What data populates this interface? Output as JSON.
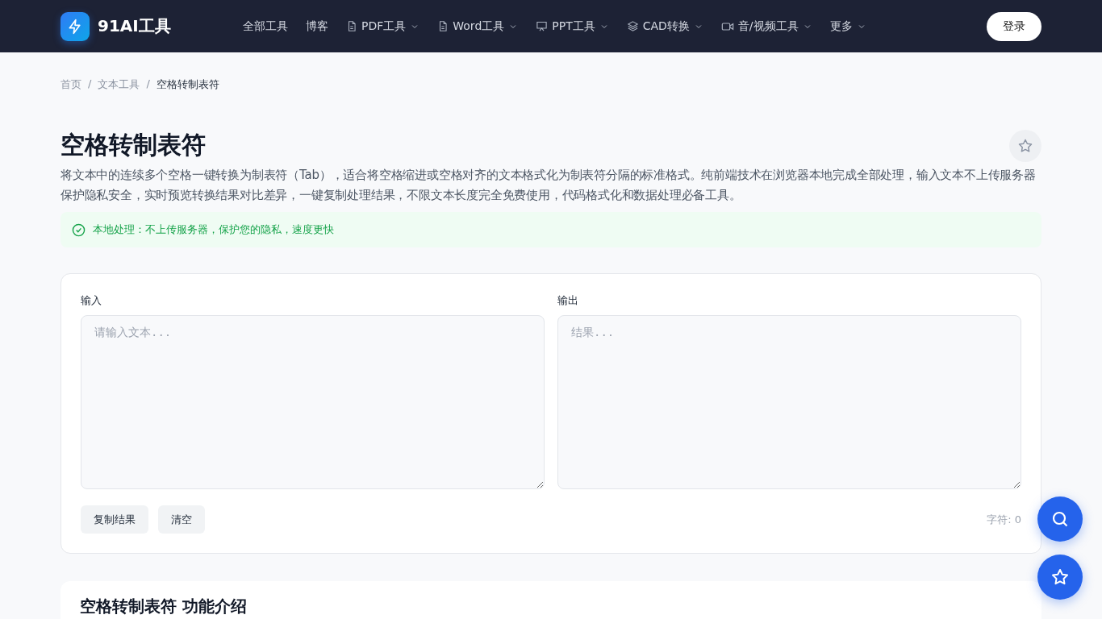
{
  "header": {
    "logo_text": "91AI工具",
    "nav": [
      {
        "label": "全部工具",
        "kind": "plain",
        "dropdown": false
      },
      {
        "label": "博客",
        "kind": "plain",
        "dropdown": false
      },
      {
        "label": "PDF工具",
        "kind": "document",
        "dropdown": true
      },
      {
        "label": "Word工具",
        "kind": "document",
        "dropdown": true
      },
      {
        "label": "PPT工具",
        "kind": "presentation",
        "dropdown": true
      },
      {
        "label": "CAD转换",
        "kind": "layers",
        "dropdown": true
      },
      {
        "label": "音/视频工具",
        "kind": "video",
        "dropdown": true
      },
      {
        "label": "更多",
        "kind": "plain",
        "dropdown": true
      }
    ],
    "login": "登录"
  },
  "breadcrumb": {
    "separator": "/",
    "items": [
      "首页",
      "文本工具",
      "空格转制表符"
    ]
  },
  "title": "空格转制表符",
  "description": "将文本中的连续多个空格一键转换为制表符（Tab），适合将空格缩进或空格对齐的文本格式化为制表符分隔的标准格式。纯前端技术在浏览器本地完成全部处理，输入文本不上传服务器保护隐私安全，实时预览转换结果对比差异，一键复制处理结果，不限文本长度完全免费使用，代码格式化和数据处理必备工具。",
  "notice": "本地处理：不上传服务器，保护您的隐私，速度更快",
  "tool": {
    "input": {
      "label": "输入",
      "placeholder": "请输入文本..."
    },
    "output": {
      "label": "输出",
      "placeholder": "结果..."
    },
    "buttons": [
      "复制结果",
      "清空"
    ],
    "char_count": "字符: 0"
  },
  "intro_heading": "空格转制表符 功能介绍"
}
